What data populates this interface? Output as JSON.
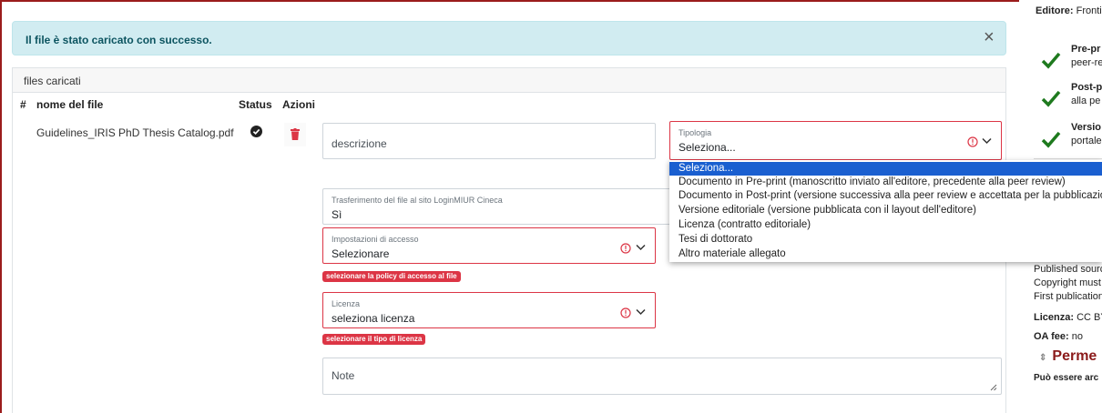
{
  "alert": {
    "message": "Il file è stato caricato con successo.",
    "close_symbol": "×"
  },
  "card": {
    "title": "files caricati"
  },
  "table": {
    "headers": {
      "index": "#",
      "name": "nome del file",
      "status": "Status",
      "actions": "Azioni"
    },
    "row": {
      "file_name": "Guidelines_IRIS PhD Thesis Catalog.pdf"
    }
  },
  "form": {
    "descrizione": {
      "placeholder": "descrizione"
    },
    "tipologia": {
      "label": "Tipologia",
      "value": "Seleziona..."
    },
    "trasferimento": {
      "label": "Trasferimento del file al sito LoginMIUR Cineca",
      "value": "Sì"
    },
    "accesso": {
      "label": "Impostazioni di accesso",
      "value": "Selezionare",
      "error": "selezionare la policy di accesso al file"
    },
    "licenza": {
      "label": "Licenza",
      "value": "seleziona licenza",
      "error": "selezionare il tipo di licenza"
    },
    "note": {
      "placeholder": "Note"
    }
  },
  "dropdown": {
    "options": [
      "Seleziona...",
      "Documento in Pre-print (manoscritto inviato all'editore, precedente alla peer review)",
      "Documento in Post-print (versione successiva alla peer review e accettata per la pubblicazione)",
      "Versione editoriale (versione pubblicata con il layout dell'editore)",
      "Licenza (contratto editoriale)",
      "Tesi di dottorato",
      "Altro materiale allegato"
    ],
    "selected_index": 0
  },
  "right_panel": {
    "editore_label": "Editore:",
    "editore_value": "Frontie",
    "items": [
      {
        "title": "Pre-pr",
        "sub": "peer-re"
      },
      {
        "title": "Post-p",
        "sub": "alla pe"
      },
      {
        "title": "Versio",
        "sub": "portale"
      }
    ],
    "notes": [
      "Published sourc",
      "Copyright must",
      "First publication"
    ],
    "licenza_label": "Licenza:",
    "licenza_value": "CC BY",
    "oa_label": "OA fee:",
    "oa_value": "no",
    "perm_heading": "Perme",
    "bottom_text": "Può essere arc"
  },
  "colors": {
    "accent": "#1a5fd0",
    "error": "#dc3545",
    "success_check": "#1e7a1e",
    "permissions_heading": "#8b1a1a"
  }
}
